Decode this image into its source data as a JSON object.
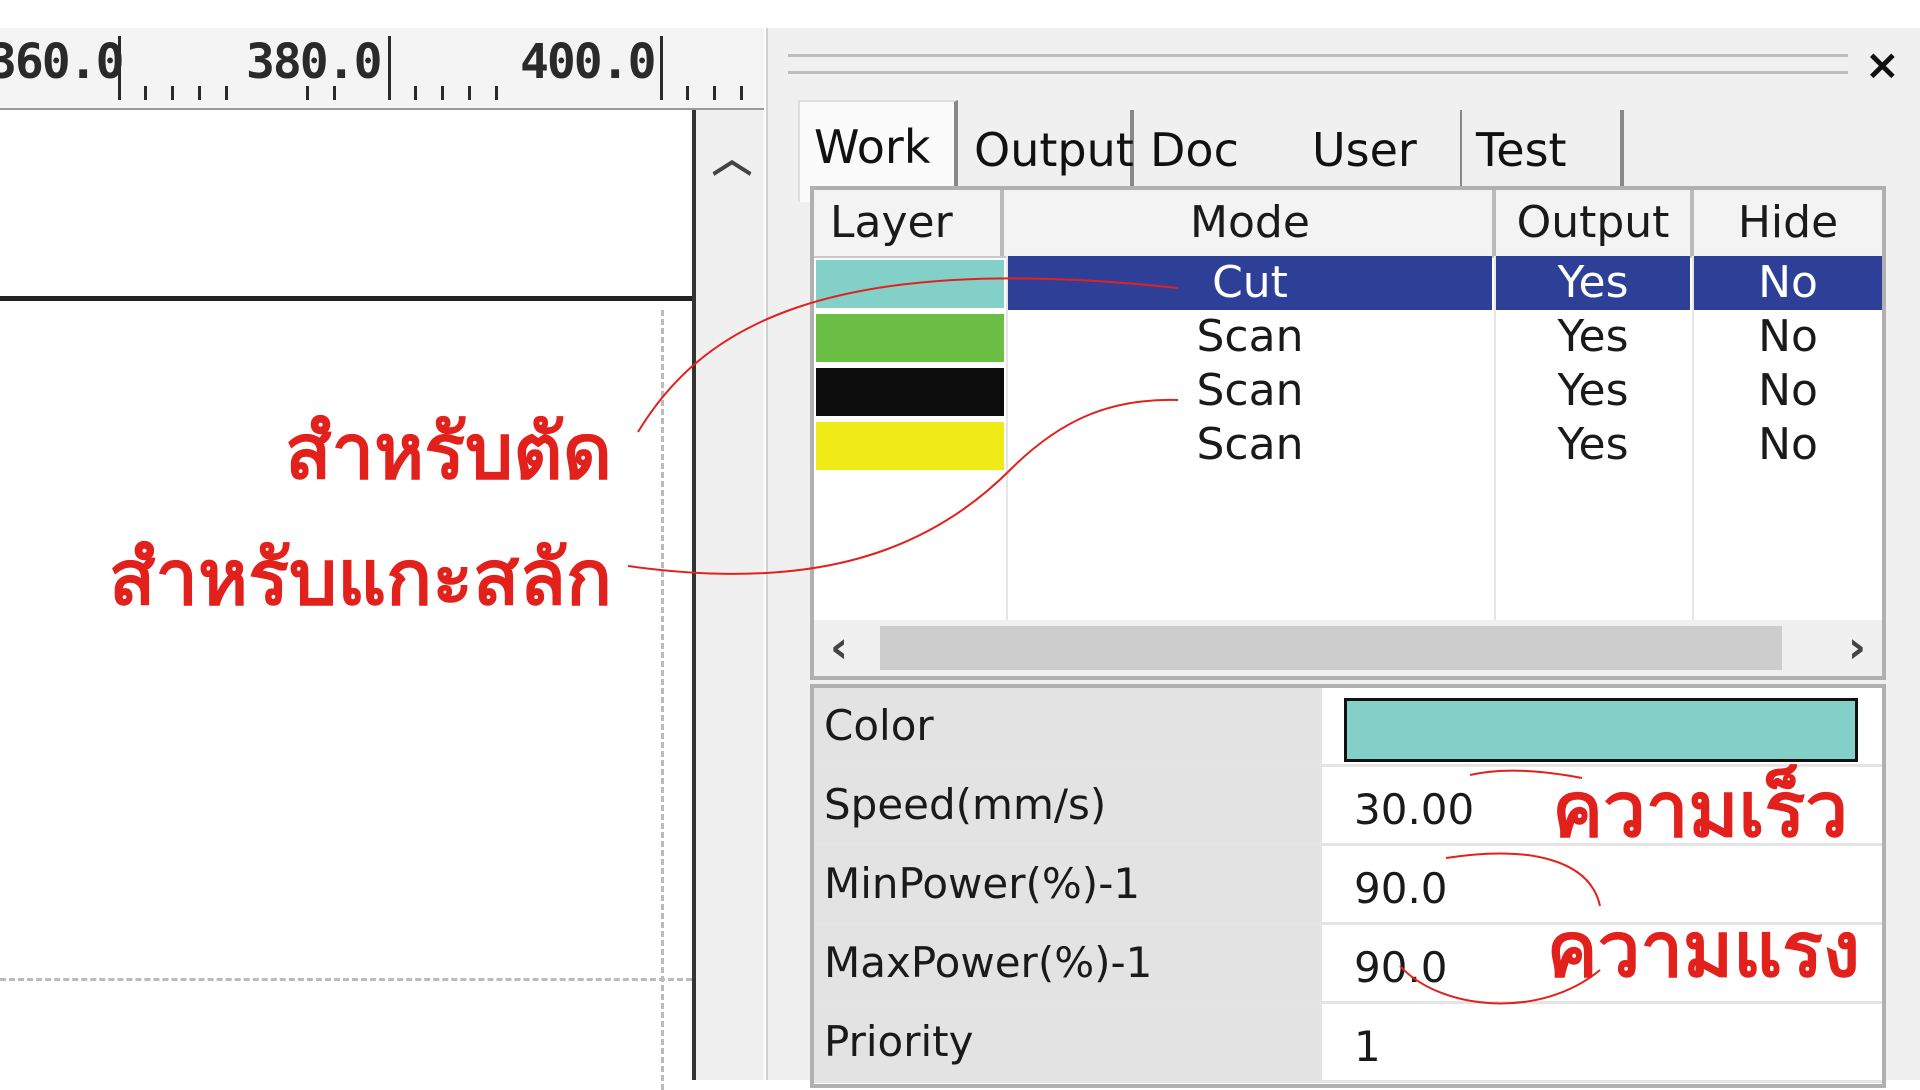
{
  "ruler": {
    "labels": [
      "360.0",
      "380.0",
      "400.0"
    ]
  },
  "annotations": {
    "cut": "สำหรับตัด",
    "engrave": "สำหรับแกะสลัก",
    "speed": "ความเร็ว",
    "power": "ความแรง"
  },
  "colors": {
    "accent_annotation": "#e2211c",
    "selection": "#2e3f98"
  },
  "panel": {
    "close_icon": "×",
    "tabs": [
      {
        "label": "Work",
        "active": true
      },
      {
        "label": "Output",
        "active": false
      },
      {
        "label": "Doc",
        "active": false
      },
      {
        "label": "User",
        "active": false
      },
      {
        "label": "Test",
        "active": false
      }
    ]
  },
  "layers": {
    "headers": [
      "Layer",
      "Mode",
      "Output",
      "Hide"
    ],
    "rows": [
      {
        "color": "#82d0c8",
        "mode": "Cut",
        "output": "Yes",
        "hide": "No",
        "selected": true
      },
      {
        "color": "#6bbf45",
        "mode": "Scan",
        "output": "Yes",
        "hide": "No",
        "selected": false
      },
      {
        "color": "#0d0d0d",
        "mode": "Scan",
        "output": "Yes",
        "hide": "No",
        "selected": false
      },
      {
        "color": "#f0ea16",
        "mode": "Scan",
        "output": "Yes",
        "hide": "No",
        "selected": false
      }
    ]
  },
  "properties": {
    "color_label": "Color",
    "color_value": "#82d0c8",
    "rows": [
      {
        "label": "Speed(mm/s)",
        "value": "30.00"
      },
      {
        "label": "MinPower(%)-1",
        "value": "90.0"
      },
      {
        "label": "MaxPower(%)-1",
        "value": "90.0"
      },
      {
        "label": "Priority",
        "value": "1"
      }
    ]
  }
}
